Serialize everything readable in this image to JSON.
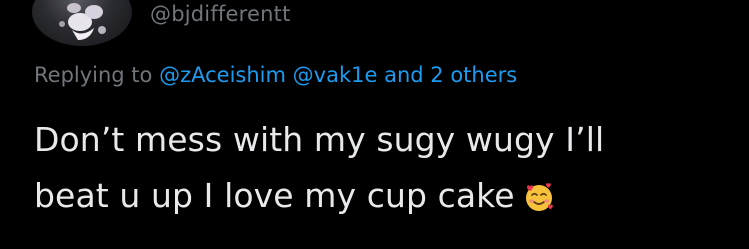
{
  "author": {
    "handle": "@bjdifferentt",
    "avatar_icon": "profile-photo"
  },
  "reply": {
    "prefix": "Replying to",
    "mentions": [
      "@zAceishim",
      "@vak1e"
    ],
    "conjunction": "and",
    "others": "2 others"
  },
  "tweet": {
    "line1": "Don’t mess with my sugy wugy I’ll",
    "line2": "beat u up I love my cup cake",
    "emoji_icon": "smiling-face-with-hearts-icon"
  },
  "colors": {
    "background": "#000000",
    "text": "#e7e9ea",
    "secondary": "#71767b",
    "link": "#1d9bf0"
  }
}
